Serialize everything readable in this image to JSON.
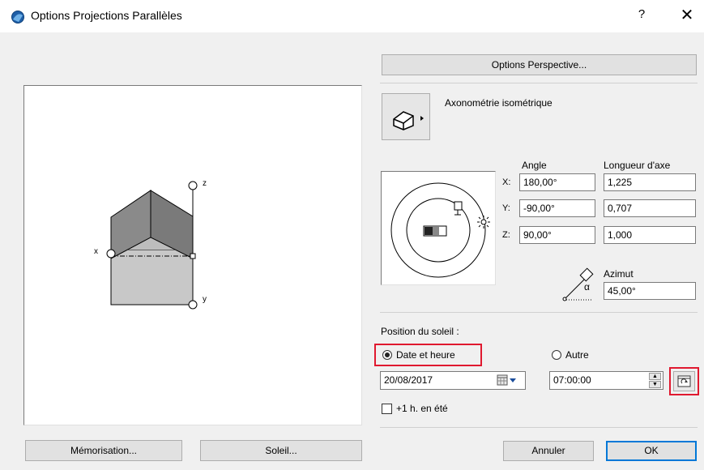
{
  "window": {
    "title": "Options Projections Parallèles",
    "help_label": "?",
    "close_label": "✕"
  },
  "preview": {
    "axis_x": "x",
    "axis_y": "y",
    "axis_z": "z"
  },
  "perspective_button": "Options Perspective...",
  "projection": {
    "type_label": "Axonométrie isométrique",
    "icon": "house-icon"
  },
  "angles": {
    "angle_header": "Angle",
    "length_header": "Longueur d'axe",
    "rows": [
      {
        "axis": "X:",
        "angle": "180,00°",
        "length": "1,225"
      },
      {
        "axis": "Y:",
        "angle": "-90,00°",
        "length": "0,707"
      },
      {
        "axis": "Z:",
        "angle": "90,00°",
        "length": "1,000"
      }
    ]
  },
  "azimuth": {
    "label": "Azimut",
    "value": "45,00°",
    "icon": "azimuth-icon",
    "symbol": "α"
  },
  "sun": {
    "section_label": "Position du soleil :",
    "date_time_label": "Date et heure",
    "date_time_selected": true,
    "other_label": "Autre",
    "other_selected": false,
    "date_value": "20/08/2017",
    "time_value": "07:00:00",
    "dst_label": "+1 h. en été",
    "dst_checked": false
  },
  "buttons": {
    "memorisation": "Mémorisation...",
    "soleil": "Soleil...",
    "annuler": "Annuler",
    "ok": "OK"
  },
  "colors": {
    "highlight": "#e0192f",
    "ok_border": "#0078d7"
  }
}
